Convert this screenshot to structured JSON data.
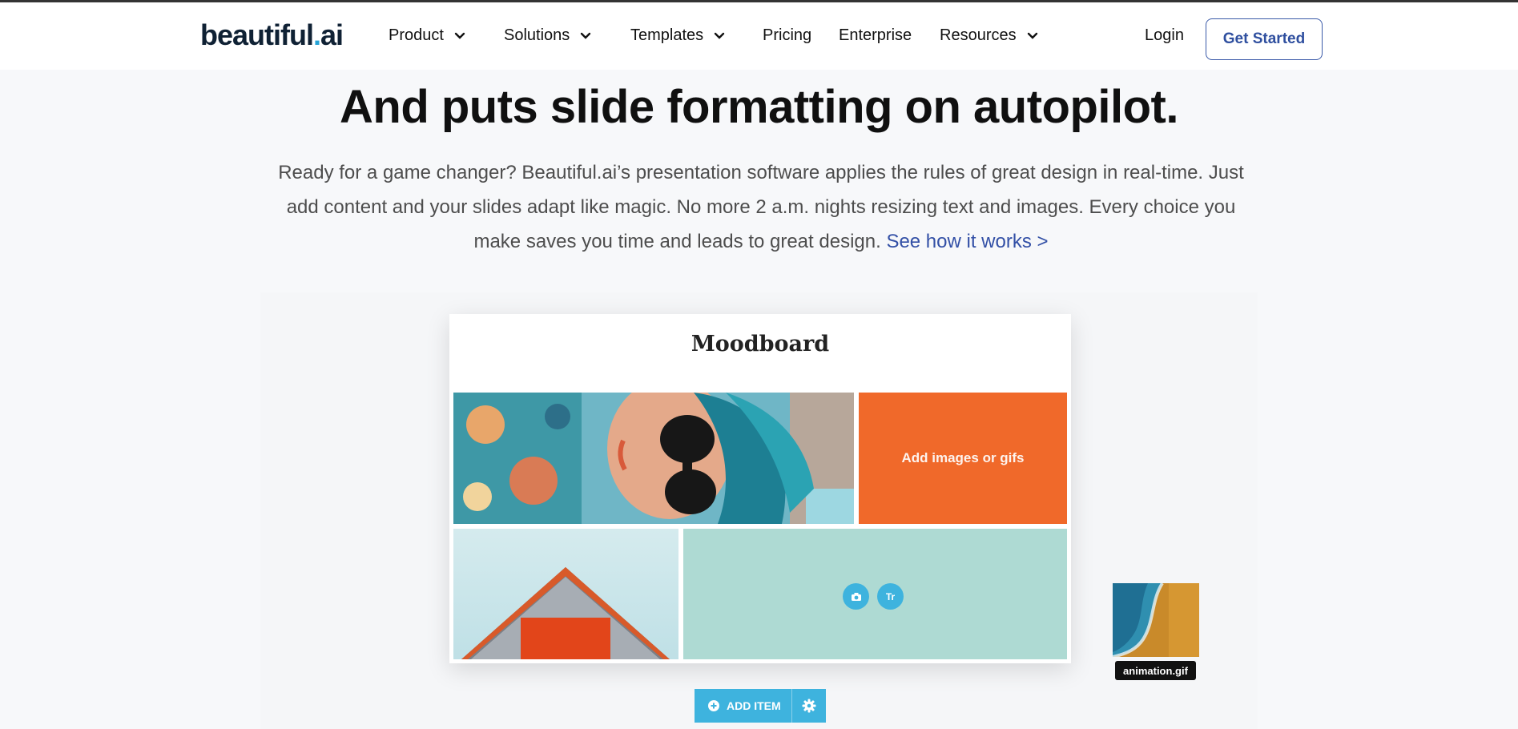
{
  "nav": {
    "logo_main": "beautiful",
    "logo_dot": ".",
    "logo_suffix": "ai",
    "items": [
      {
        "label": "Product",
        "dropdown": true
      },
      {
        "label": "Solutions",
        "dropdown": true
      },
      {
        "label": "Templates",
        "dropdown": true
      },
      {
        "label": "Pricing",
        "dropdown": false
      },
      {
        "label": "Enterprise",
        "dropdown": false
      },
      {
        "label": "Resources",
        "dropdown": true
      }
    ],
    "login": "Login",
    "cta": "Get Started"
  },
  "hero": {
    "headline": "And puts slide formatting on autopilot.",
    "lede": "Ready for a game changer? Beautiful.ai’s presentation software applies the rules of great design in real-time. Just add content and your slides adapt like magic. No more 2 a.m. nights resizing text and images. Every choice you make saves you time and leads to great design.",
    "link": "See how it works >"
  },
  "slide": {
    "title": "Moodboard",
    "placeholder_text": "Add images or gifs",
    "icon_text": "Tr",
    "add_item": "ADD ITEM",
    "drag_file": "animation.gif"
  },
  "colors": {
    "accent": "#3eb3de",
    "orange": "#f0692a",
    "mint": "#aedad3",
    "link": "#3350a6",
    "logo": "#0f2134"
  }
}
